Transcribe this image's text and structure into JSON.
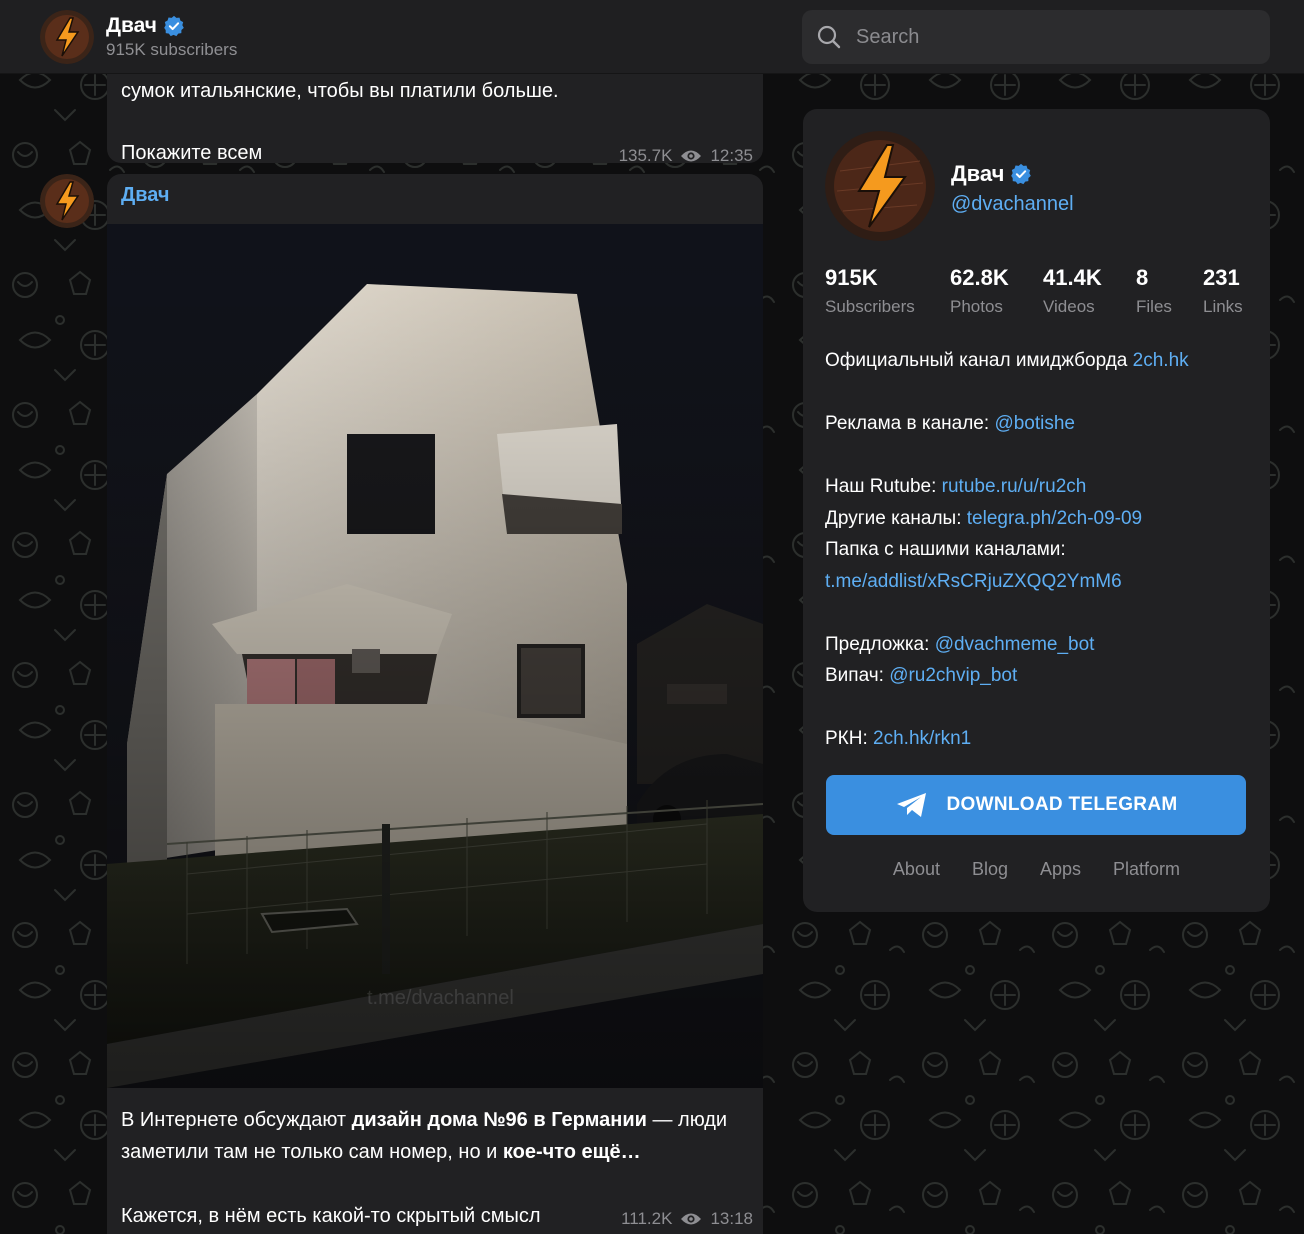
{
  "header": {
    "channel_name": "Двач",
    "subscribers": "915K subscribers"
  },
  "search": {
    "placeholder": "Search"
  },
  "feed": {
    "prev_post": {
      "line1": "сумок итальянские, чтобы вы платили больше.",
      "line2": "Покажите всем",
      "views": "135.7K",
      "time": "12:35"
    },
    "post": {
      "author": "Двач",
      "caption_part1": "В Интернете обсуждают ",
      "caption_bold1": "дизайн дома №96 в Германии",
      "caption_part2": " — люди заметили там не только сам номер, но и ",
      "caption_bold2": "кое-что ещё…",
      "caption_line3": "Кажется, в нём есть какой-то скрытый смысл",
      "views": "111.2K",
      "time": "13:18",
      "watermark": "t.me/dvachannel"
    }
  },
  "panel": {
    "name": "Двач",
    "handle": "@dvachannel",
    "stats": [
      {
        "value": "915K",
        "label": "Subscribers"
      },
      {
        "value": "62.8K",
        "label": "Photos"
      },
      {
        "value": "41.4K",
        "label": "Videos"
      },
      {
        "value": "8",
        "label": "Files"
      },
      {
        "value": "231",
        "label": "Links"
      }
    ],
    "desc": {
      "official_text": "Официальный канал имиджборда ",
      "official_link": "2ch.hk",
      "ads_text": "Реклама в канале: ",
      "ads_link": "@botishe",
      "rutube_text": "Наш Rutube: ",
      "rutube_link": "rutube.ru/u/ru2ch",
      "other_text": "Другие каналы: ",
      "other_link": "telegra.ph/2ch-09-09",
      "folder_text": "Папка с нашими каналами:",
      "folder_link": "t.me/addlist/xRsCRjuZXQQ2YmM6",
      "suggest_text": "Предложка: ",
      "suggest_link": "@dvachmeme_bot",
      "vip_text": "Випач: ",
      "vip_link": "@ru2chvip_bot",
      "rkn_text": "РКН: ",
      "rkn_link": "2ch.hk/rkn1"
    },
    "download_label": "DOWNLOAD TELEGRAM",
    "footer": [
      "About",
      "Blog",
      "Apps",
      "Platform"
    ]
  },
  "colors": {
    "accent": "#3a8fe0",
    "link": "#5eaef3",
    "bubble": "#212123",
    "header": "#1f1f21",
    "verified": "#3a8fe0"
  },
  "icons": [
    "search-icon",
    "verified-icon",
    "eye-icon",
    "telegram-plane-icon"
  ]
}
